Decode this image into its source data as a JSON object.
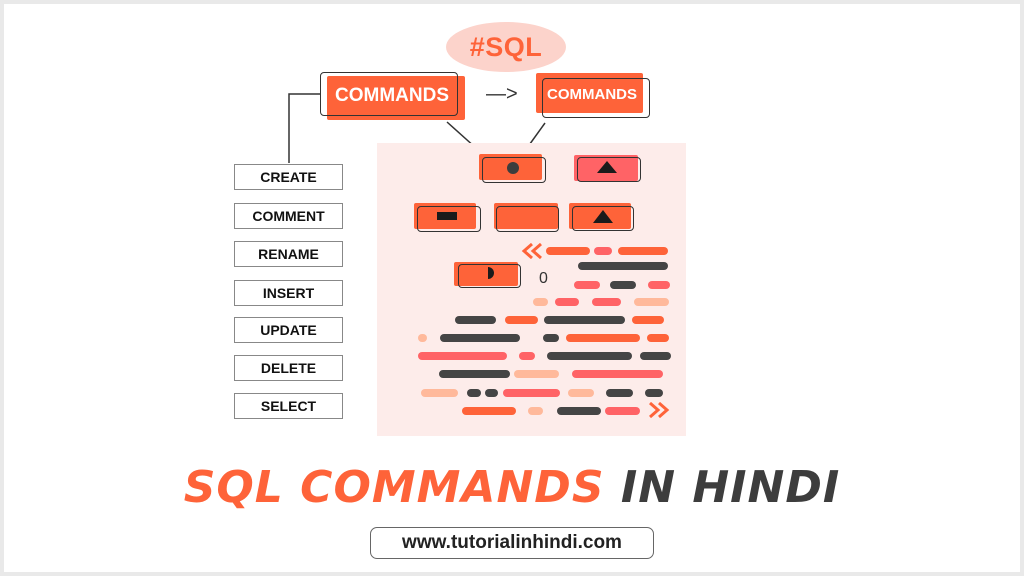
{
  "hero": {
    "tag": "#SQL",
    "commands_primary": "COMMANDS",
    "commands_secondary": "COMMANDS",
    "arrow": "—>"
  },
  "command_list": [
    {
      "label": "CREATE"
    },
    {
      "label": "COMMENT"
    },
    {
      "label": "RENAME"
    },
    {
      "label": "INSERT"
    },
    {
      "label": "UPDATE"
    },
    {
      "label": "DELETE"
    },
    {
      "label": "SELECT"
    }
  ],
  "diagram": {
    "nodes": [
      {
        "name": "node-circle",
        "icon": "circle-icon",
        "color": "#fe6339"
      },
      {
        "name": "node-triangle-top",
        "icon": "triangle-icon",
        "color": "#ff6366"
      },
      {
        "name": "node-rectangle",
        "icon": "rectangle-icon",
        "color": "#fe6339"
      },
      {
        "name": "node-empty",
        "icon": "",
        "color": "#fe6339"
      },
      {
        "name": "node-triangle-bottom",
        "icon": "triangle-icon",
        "color": "#fe6339"
      },
      {
        "name": "node-half-circle",
        "icon": "half-circle-icon",
        "color": "#fe6339"
      }
    ],
    "zero_label": "0",
    "start_chevrons": "«",
    "end_chevrons": "»"
  },
  "colors": {
    "orange": "#fe6339",
    "pink": "#ff6366",
    "peach": "#ffb99b",
    "dark": "#454545",
    "panel": "#fdecea",
    "tag_bg": "#fcd3cb"
  },
  "code_lines": [
    [
      [
        "orange",
        0,
        1
      ],
      [
        "pink",
        1,
        1
      ],
      [
        "orange",
        2,
        1
      ]
    ],
    [
      [
        "dark",
        0,
        1
      ]
    ],
    [
      [
        "pink",
        0,
        1
      ],
      [
        "dark",
        1,
        1
      ],
      [
        "pink",
        2,
        1
      ]
    ],
    [
      [
        "peach",
        0,
        1
      ],
      [
        "pink",
        1,
        1
      ],
      [
        "pink",
        2,
        1
      ],
      [
        "peach",
        3,
        1
      ]
    ],
    [
      [
        "dark",
        0,
        1
      ],
      [
        "orange",
        1,
        1
      ],
      [
        "dark",
        2,
        1
      ],
      [
        "orange",
        3,
        1
      ]
    ],
    [
      [
        "peach",
        0,
        1
      ],
      [
        "dark",
        1,
        1
      ],
      [
        "dark",
        2,
        1
      ],
      [
        "orange",
        3,
        1
      ],
      [
        "orange",
        4,
        1
      ]
    ],
    [
      [
        "pink",
        0,
        1
      ],
      [
        "pink",
        1,
        1
      ],
      [
        "dark",
        2,
        1
      ],
      [
        "dark",
        3,
        1
      ]
    ],
    [
      [
        "dark",
        0,
        1
      ],
      [
        "peach",
        1,
        1
      ],
      [
        "pink",
        2,
        1
      ]
    ],
    [
      [
        "peach",
        0,
        1
      ],
      [
        "dark",
        1,
        1
      ],
      [
        "dark",
        2,
        1
      ],
      [
        "pink",
        3,
        1
      ],
      [
        "peach",
        4,
        1
      ],
      [
        "dark",
        5,
        1
      ],
      [
        "dark",
        6,
        1
      ]
    ],
    [
      [
        "orange",
        0,
        1
      ],
      [
        "peach",
        1,
        1
      ],
      [
        "dark",
        2,
        1
      ],
      [
        "pink",
        3,
        1
      ]
    ]
  ],
  "title": {
    "part1": "SQL COMMANDS",
    "part2": "IN HINDI"
  },
  "footer": {
    "url": "www.tutorialinhindi.com"
  }
}
